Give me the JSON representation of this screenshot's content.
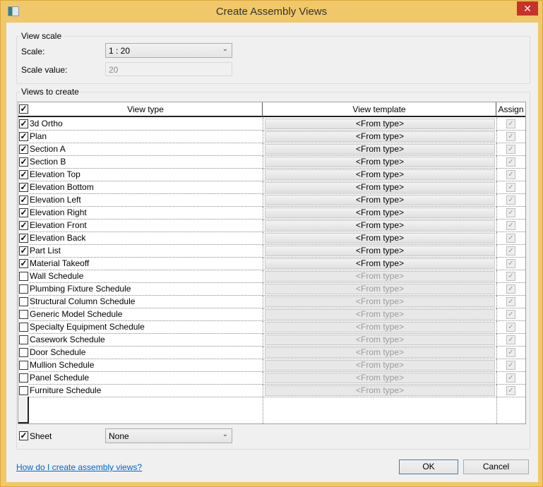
{
  "window": {
    "title": "Create Assembly Views",
    "close": "✕"
  },
  "view_scale": {
    "group_label": "View scale",
    "scale_label": "Scale:",
    "scale_value": "1 : 20",
    "scale_value_label": "Scale value:",
    "scale_value_input": "20"
  },
  "views": {
    "group_label": "Views to create",
    "headers": {
      "view_type": "View type",
      "view_template": "View template",
      "assign": "Assign"
    },
    "rows": [
      {
        "name": "3d Ortho",
        "checked": true,
        "template": "<From type>"
      },
      {
        "name": "Plan",
        "checked": true,
        "template": "<From type>"
      },
      {
        "name": "Section A",
        "checked": true,
        "template": "<From type>"
      },
      {
        "name": "Section B",
        "checked": true,
        "template": "<From type>"
      },
      {
        "name": "Elevation Top",
        "checked": true,
        "template": "<From type>"
      },
      {
        "name": "Elevation Bottom",
        "checked": true,
        "template": "<From type>"
      },
      {
        "name": "Elevation Left",
        "checked": true,
        "template": "<From type>"
      },
      {
        "name": "Elevation Right",
        "checked": true,
        "template": "<From type>"
      },
      {
        "name": "Elevation Front",
        "checked": true,
        "template": "<From type>"
      },
      {
        "name": "Elevation Back",
        "checked": true,
        "template": "<From type>"
      },
      {
        "name": "Part List",
        "checked": true,
        "template": "<From type>"
      },
      {
        "name": "Material Takeoff",
        "checked": true,
        "template": "<From type>"
      },
      {
        "name": "Wall Schedule",
        "checked": false,
        "template": "<From type>"
      },
      {
        "name": "Plumbing Fixture Schedule",
        "checked": false,
        "template": "<From type>"
      },
      {
        "name": "Structural Column Schedule",
        "checked": false,
        "template": "<From type>"
      },
      {
        "name": "Generic Model Schedule",
        "checked": false,
        "template": "<From type>"
      },
      {
        "name": "Specialty Equipment Schedule",
        "checked": false,
        "template": "<From type>"
      },
      {
        "name": "Casework Schedule",
        "checked": false,
        "template": "<From type>"
      },
      {
        "name": "Door Schedule",
        "checked": false,
        "template": "<From type>"
      },
      {
        "name": "Mullion Schedule",
        "checked": false,
        "template": "<From type>"
      },
      {
        "name": "Panel Schedule",
        "checked": false,
        "template": "<From type>"
      },
      {
        "name": "Furniture Schedule",
        "checked": false,
        "template": "<From type>"
      }
    ]
  },
  "sheet": {
    "label": "Sheet",
    "checked": true,
    "value": "None"
  },
  "footer": {
    "help_link": "How do I create assembly views?",
    "ok": "OK",
    "cancel": "Cancel"
  }
}
